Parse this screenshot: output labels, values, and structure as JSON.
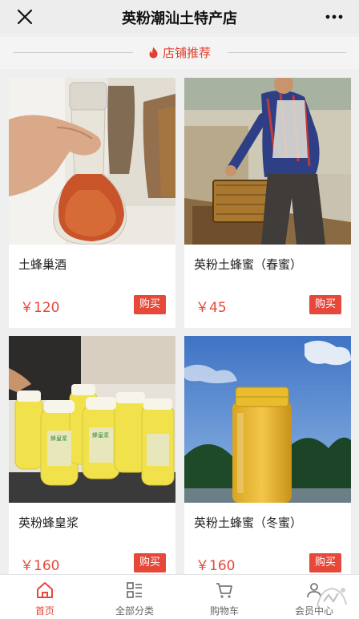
{
  "header": {
    "title": "英粉潮汕土特产店",
    "close_icon": "close-icon",
    "more_icon": "more-icon"
  },
  "section": {
    "label": "店铺推荐",
    "icon": "flame-icon"
  },
  "products": [
    {
      "name": "土蜂巢酒",
      "price": "￥120",
      "buy_label": "购买"
    },
    {
      "name": "英粉土蜂蜜（春蜜）",
      "price": "￥45",
      "buy_label": "购买"
    },
    {
      "name": "英粉蜂皇浆",
      "price": "￥160",
      "buy_label": "购买"
    },
    {
      "name": "英粉土蜂蜜（冬蜜）",
      "price": "￥160",
      "buy_label": "购买"
    }
  ],
  "product_images": {
    "jar_label": "蜂皇浆"
  },
  "tabbar": {
    "items": [
      {
        "label": "首页",
        "icon": "home-icon",
        "active": true
      },
      {
        "label": "全部分类",
        "icon": "category-icon",
        "active": false
      },
      {
        "label": "购物车",
        "icon": "cart-icon",
        "active": false
      },
      {
        "label": "会员中心",
        "icon": "member-icon",
        "active": false
      }
    ]
  },
  "colors": {
    "accent": "#e6483a",
    "section": "#e0402e",
    "background": "#efefef"
  }
}
